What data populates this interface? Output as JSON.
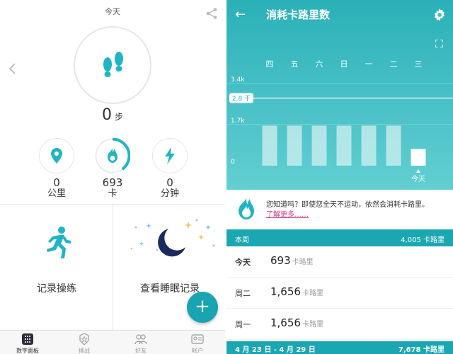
{
  "dashboard": {
    "title": "今天",
    "steps": {
      "value": "0",
      "unit": "步"
    },
    "metrics": [
      {
        "value": "0",
        "label": "公里",
        "icon": "location-pin-icon"
      },
      {
        "value": "693",
        "label": "卡",
        "icon": "flame-icon",
        "progress": 0.4
      },
      {
        "value": "0",
        "label": "分钟",
        "icon": "lightning-icon"
      }
    ],
    "tiles": [
      {
        "label": "记录操练",
        "icon": "running-person-icon"
      },
      {
        "label": "查看睡眠记录",
        "icon": "moon-stars-icon"
      }
    ],
    "nav": [
      {
        "label": "数字面板",
        "icon": "dashboard-icon",
        "active": true
      },
      {
        "label": "挑战",
        "icon": "star-badge-icon",
        "active": false
      },
      {
        "label": "好友",
        "icon": "friends-icon",
        "active": false
      },
      {
        "label": "帐户",
        "icon": "account-card-icon",
        "active": false
      }
    ],
    "colors": {
      "accent": "#18a4b0",
      "flame": "#1fb5c4"
    }
  },
  "calories": {
    "title": "消耗卡路里数",
    "tip_text": "您知道吗？即使您全天不运动，依然会消耗卡路里。",
    "tip_link": "了解更多……",
    "week_label": "本周",
    "week_total": "4,005 卡路里",
    "rows": [
      {
        "day": "今天",
        "value": "693",
        "unit": "卡路里",
        "bold": true
      },
      {
        "day": "周二",
        "value": "1,656",
        "unit": "卡路里",
        "bold": false
      },
      {
        "day": "周一",
        "value": "1,656",
        "unit": "卡路里",
        "bold": false
      }
    ],
    "prev_week_label": "4 月 23 日 - 4 月 29 日",
    "prev_week_total": "7,678 卡路里",
    "colors": {
      "header": "#2bb0b8",
      "bar": "#ffffff"
    }
  },
  "chart_data": {
    "type": "bar",
    "categories": [
      "四",
      "五",
      "六",
      "日",
      "一",
      "二",
      "三"
    ],
    "values": [
      1656,
      1656,
      1656,
      1656,
      1656,
      1656,
      693
    ],
    "x_highlight_label": "今天",
    "goal": 2800,
    "goal_label": "2.8 千",
    "ytick_labels": [
      "3.4k",
      "1.7k",
      "0"
    ],
    "yticks": [
      3400,
      1700,
      0
    ],
    "ylim": [
      0,
      3400
    ]
  }
}
